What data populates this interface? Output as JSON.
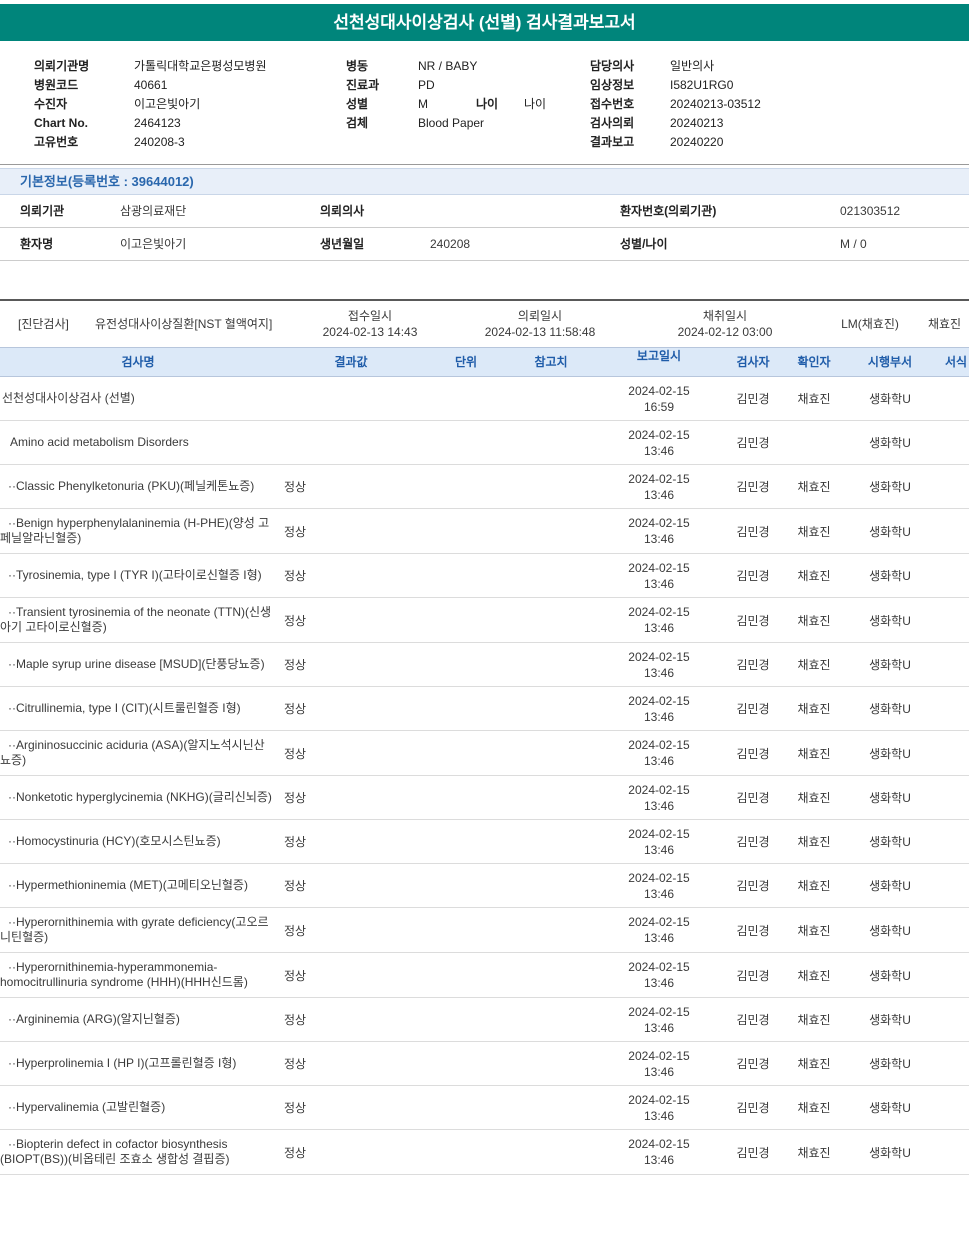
{
  "title": "선천성대사이상검사 (선별) 검사결과보고서",
  "colors": {
    "header_teal": "#00857B",
    "section_bar_bg": "#E8EFF9",
    "section_blue_text": "#2A67AD",
    "table_header_bg": "#DCE9F8",
    "table_header_text": "#1F5CA9"
  },
  "header_info": {
    "col1": [
      {
        "label": "의뢰기관명",
        "value": "가톨릭대학교은평성모병원"
      },
      {
        "label": "병원코드",
        "value": "40661"
      },
      {
        "label": "수진자",
        "value": "이고은빛아기"
      },
      {
        "label": "Chart No.",
        "value": "2464123"
      },
      {
        "label": "고유번호",
        "value": "240208-3"
      }
    ],
    "col2": [
      {
        "label": "병동",
        "value": "NR / BABY"
      },
      {
        "label": "진료과",
        "value": "PD"
      },
      {
        "label": "성별",
        "value": "M",
        "label2": "나이",
        "value2": "나이"
      },
      {
        "label": "검체",
        "value": "Blood Paper"
      }
    ],
    "col3": [
      {
        "label": "담당의사",
        "value": "일반의사"
      },
      {
        "label": "임상정보",
        "value": "I582U1RG0"
      },
      {
        "label": "접수번호",
        "value": "20240213-03512"
      },
      {
        "label": "검사의뢰",
        "value": "20240213"
      },
      {
        "label": "결과보고",
        "value": "20240220"
      }
    ]
  },
  "basic_info": {
    "section_title": "기본정보(등록번호 : 39644012)",
    "rows": [
      [
        {
          "label": "의뢰기관",
          "value": "삼광의료재단"
        },
        {
          "label": "의뢰의사",
          "value": ""
        },
        {
          "label": "환자번호(의뢰기관)",
          "value": "021303512"
        }
      ],
      [
        {
          "label": "환자명",
          "value": "이고은빛아기"
        },
        {
          "label": "생년월일",
          "value": "240208"
        },
        {
          "label": "성별/나이",
          "value": "M / 0"
        }
      ]
    ]
  },
  "diagnostic": {
    "tag": "[진단검사]",
    "test_name": "유전성대사이상질환[NST 혈액여지]",
    "receipt_label": "접수일시",
    "receipt_value": "2024-02-13 14:43",
    "request_label": "의뢰일시",
    "request_value": "2024-02-13 11:58:48",
    "collect_label": "채취일시",
    "collect_value": "2024-02-12 03:00",
    "collector": "LM(채효진)",
    "extra": "채효진"
  },
  "results_table": {
    "headers": [
      "검사명",
      "결과값",
      "단위",
      "참고치",
      "보고일시",
      "검사자",
      "확인자",
      "시행부서",
      "서식"
    ],
    "rows": [
      {
        "name": "선천성대사이상검사 (선별)",
        "indent": 0,
        "result": "",
        "date": "2024-02-15",
        "time": "16:59",
        "tester": "김민경",
        "confirmer": "채효진",
        "dept": "생화학U"
      },
      {
        "name": "Amino acid metabolism Disorders",
        "indent": 1,
        "result": "",
        "date": "2024-02-15",
        "time": "13:46",
        "tester": "김민경",
        "confirmer": "",
        "dept": "생화학U"
      },
      {
        "name": "··Classic Phenylketonuria (PKU)(페닐케톤뇨증)",
        "indent": 2,
        "result": "정상",
        "date": "2024-02-15",
        "time": "13:46",
        "tester": "김민경",
        "confirmer": "채효진",
        "dept": "생화학U"
      },
      {
        "name": "··Benign hyperphenylalaninemia (H-PHE)(양성 고페닐알라닌혈증)",
        "indent": 2,
        "result": "정상",
        "date": "2024-02-15",
        "time": "13:46",
        "tester": "김민경",
        "confirmer": "채효진",
        "dept": "생화학U"
      },
      {
        "name": "··Tyrosinemia, type I (TYR I)(고타이로신혈증 I형)",
        "indent": 2,
        "result": "정상",
        "date": "2024-02-15",
        "time": "13:46",
        "tester": "김민경",
        "confirmer": "채효진",
        "dept": "생화학U"
      },
      {
        "name": "··Transient tyrosinemia of the neonate (TTN)(신생아기 고타이로신혈증)",
        "indent": 2,
        "result": "정상",
        "date": "2024-02-15",
        "time": "13:46",
        "tester": "김민경",
        "confirmer": "채효진",
        "dept": "생화학U"
      },
      {
        "name": "··Maple syrup urine disease [MSUD](단풍당뇨증)",
        "indent": 2,
        "result": "정상",
        "date": "2024-02-15",
        "time": "13:46",
        "tester": "김민경",
        "confirmer": "채효진",
        "dept": "생화학U"
      },
      {
        "name": "··Citrullinemia, type I (CIT)(시트룰린혈증 I형)",
        "indent": 2,
        "result": "정상",
        "date": "2024-02-15",
        "time": "13:46",
        "tester": "김민경",
        "confirmer": "채효진",
        "dept": "생화학U"
      },
      {
        "name": "··Argininosuccinic aciduria (ASA)(알지노석시닌산뇨증)",
        "indent": 2,
        "result": "정상",
        "date": "2024-02-15",
        "time": "13:46",
        "tester": "김민경",
        "confirmer": "채효진",
        "dept": "생화학U"
      },
      {
        "name": "··Nonketotic hyperglycinemia (NKHG)(글리신뇌증)",
        "indent": 2,
        "result": "정상",
        "date": "2024-02-15",
        "time": "13:46",
        "tester": "김민경",
        "confirmer": "채효진",
        "dept": "생화학U"
      },
      {
        "name": "··Homocystinuria (HCY)(호모시스틴뇨증)",
        "indent": 2,
        "result": "정상",
        "date": "2024-02-15",
        "time": "13:46",
        "tester": "김민경",
        "confirmer": "채효진",
        "dept": "생화학U"
      },
      {
        "name": "··Hypermethioninemia (MET)(고메티오닌혈증)",
        "indent": 2,
        "result": "정상",
        "date": "2024-02-15",
        "time": "13:46",
        "tester": "김민경",
        "confirmer": "채효진",
        "dept": "생화학U"
      },
      {
        "name": "··Hyperornithinemia with gyrate deficiency(고오르니틴혈증)",
        "indent": 2,
        "result": "정상",
        "date": "2024-02-15",
        "time": "13:46",
        "tester": "김민경",
        "confirmer": "채효진",
        "dept": "생화학U"
      },
      {
        "name": "··Hyperornithinemia-hyperammonemia-homocitrullinuria syndrome (HHH)(HHH신드롬)",
        "indent": 2,
        "result": "정상",
        "date": "2024-02-15",
        "time": "13:46",
        "tester": "김민경",
        "confirmer": "채효진",
        "dept": "생화학U"
      },
      {
        "name": "··Argininemia (ARG)(알지닌혈증)",
        "indent": 2,
        "result": "정상",
        "date": "2024-02-15",
        "time": "13:46",
        "tester": "김민경",
        "confirmer": "채효진",
        "dept": "생화학U"
      },
      {
        "name": "··Hyperprolinemia I (HP I)(고프롤린혈증 I형)",
        "indent": 2,
        "result": "정상",
        "date": "2024-02-15",
        "time": "13:46",
        "tester": "김민경",
        "confirmer": "채효진",
        "dept": "생화학U"
      },
      {
        "name": "··Hypervalinemia (고발린혈증)",
        "indent": 2,
        "result": "정상",
        "date": "2024-02-15",
        "time": "13:46",
        "tester": "김민경",
        "confirmer": "채효진",
        "dept": "생화학U"
      },
      {
        "name": "··Biopterin defect in cofactor biosynthesis (BIOPT(BS))(비옵테린 조효소 생합성 결핍증)",
        "indent": 2,
        "result": "정상",
        "date": "2024-02-15",
        "time": "13:46",
        "tester": "김민경",
        "confirmer": "채효진",
        "dept": "생화학U"
      }
    ]
  }
}
